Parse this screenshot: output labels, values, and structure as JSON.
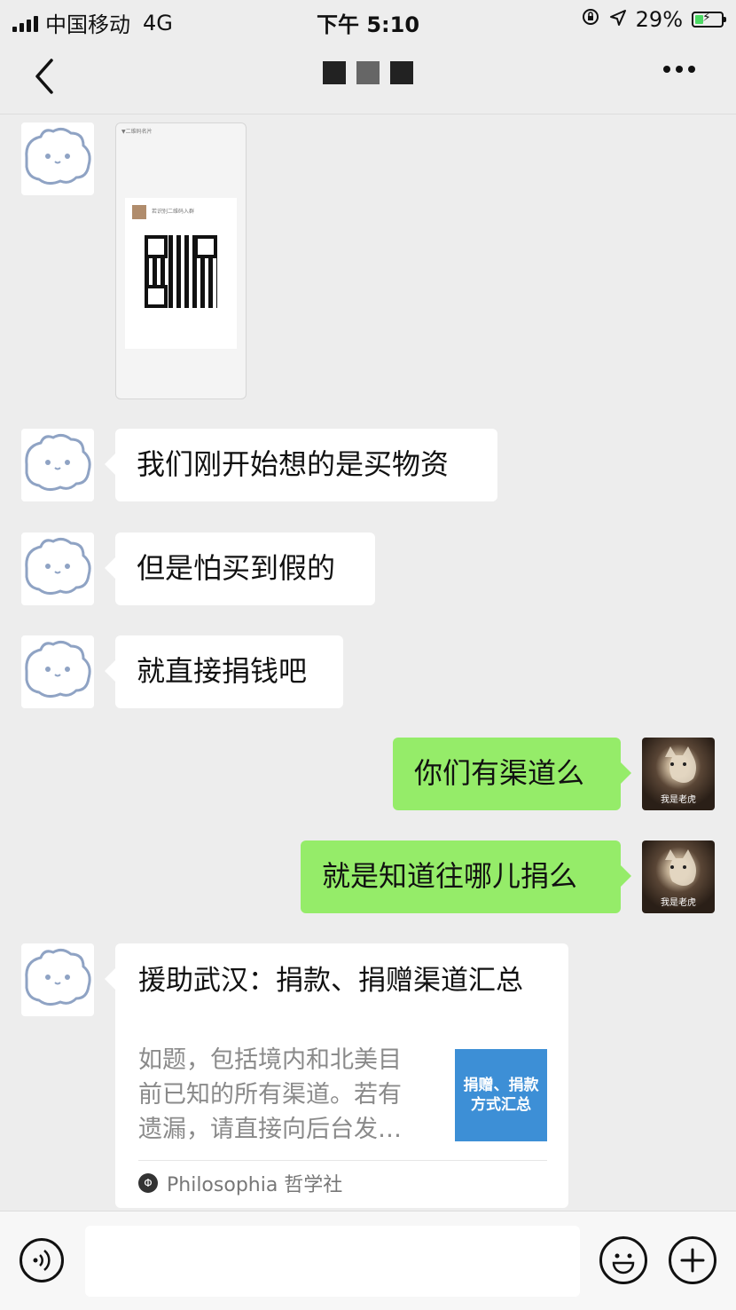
{
  "status_bar": {
    "carrier": "中国移动",
    "network": "4G",
    "time": "下午 5:10",
    "battery_percent": "29%"
  },
  "nav": {
    "back_icon": "chevron-left-icon",
    "more_icon": "more-dots-icon"
  },
  "messages": [
    {
      "type": "image",
      "from": "contact",
      "image_header": "▼二维码名片",
      "image_caption": "若识别二维码入群"
    },
    {
      "type": "text",
      "from": "contact",
      "text": "我们刚开始想的是买物资"
    },
    {
      "type": "text",
      "from": "contact",
      "text": "但是怕买到假的"
    },
    {
      "type": "text",
      "from": "contact",
      "text": "就直接捐钱吧"
    },
    {
      "type": "text",
      "from": "me",
      "text": "你们有渠道么"
    },
    {
      "type": "text",
      "from": "me",
      "text": "就是知道往哪儿捐么"
    },
    {
      "type": "article",
      "from": "contact",
      "title": "援助武汉：捐款、捐赠渠道汇总",
      "description": "如题，包括境内和北美目前已知的所有渠道。若有遗漏，请直接向后台发…",
      "thumb_line1": "捐赠、捐款",
      "thumb_line2": "方式汇总",
      "source": "Philosophia 哲学社"
    }
  ],
  "avatars": {
    "me_caption": "我是老虎"
  },
  "input_bar": {
    "voice_icon": "voice-icon",
    "emoji_icon": "emoji-icon",
    "plus_icon": "plus-icon",
    "value": ""
  },
  "colors": {
    "background": "#ededed",
    "outgoing_bubble": "#95ec69",
    "incoming_bubble": "#ffffff",
    "article_thumb": "#3d8fd6"
  }
}
